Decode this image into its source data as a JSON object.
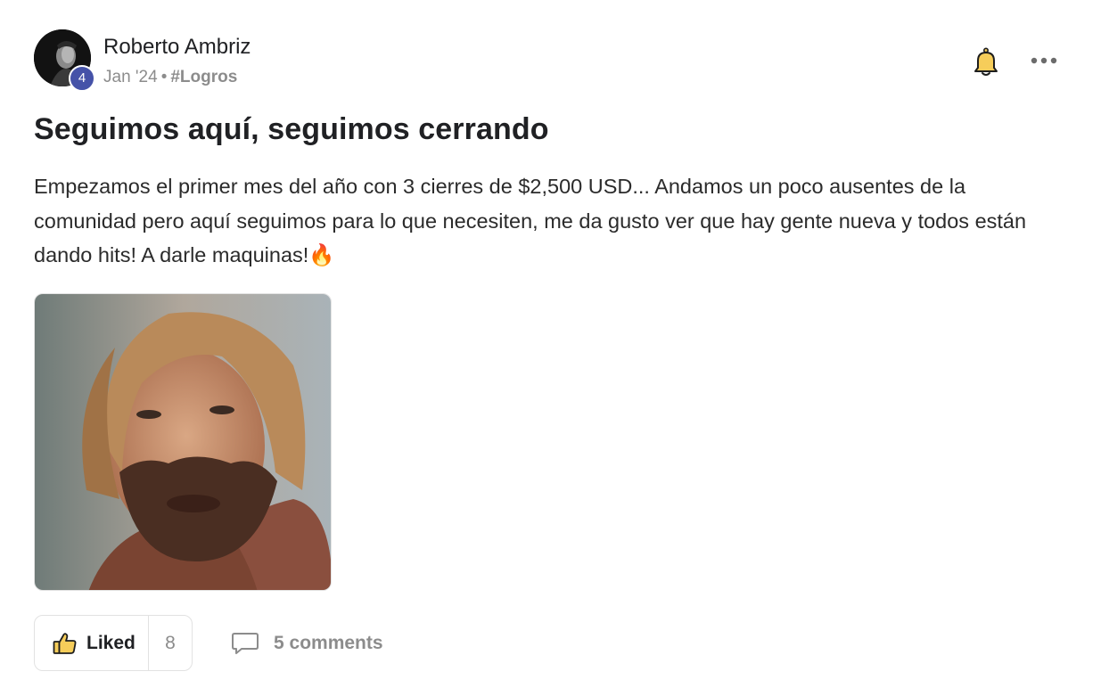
{
  "post": {
    "author": {
      "name": "Roberto Ambriz",
      "level": "4"
    },
    "date": "Jan '24",
    "separator": "•",
    "category": "#Logros",
    "title": "Seguimos aquí, seguimos cerrando",
    "body": "Empezamos el primer mes del año con 3 cierres de $2,500 USD... Andamos un poco ausentes de la comunidad pero aquí seguimos para lo que necesiten, me da gusto ver que hay gente nueva y todos están dando hits! A darle maquinas!🔥",
    "media_icon": "gif-image"
  },
  "actions": {
    "like_label": "Liked",
    "like_count": "8",
    "comments_label": "5 comments"
  },
  "icons": {
    "bell": "bell-icon",
    "more": "more-horizontal-icon",
    "like": "thumbs-up-icon",
    "comments": "comment-bubble-icon"
  },
  "colors": {
    "badge": "#4552a8",
    "bell_fill": "#f6cd5a",
    "thumb_fill": "#f6cd5a",
    "muted_text": "#8c8c8c"
  }
}
